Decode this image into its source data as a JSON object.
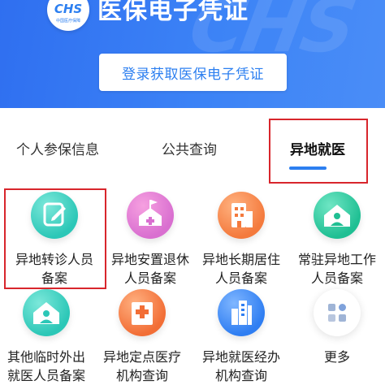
{
  "banner": {
    "logo_mark": "CHS",
    "logo_org": "中国医疗保障",
    "watermark": "CHS",
    "title": "医保电子凭证",
    "login_button": "登录获取医保电子凭证"
  },
  "tabs": [
    {
      "label": "个人参保信息",
      "active": false
    },
    {
      "label": "公共查询",
      "active": false
    },
    {
      "label": "异地就医",
      "active": true
    }
  ],
  "services": [
    {
      "line1": "异地转诊人员",
      "line2": "备案",
      "icon": "edit-icon",
      "color": "#2cc7b7"
    },
    {
      "line1": "异地安置退休",
      "line2": "人员备案",
      "icon": "house-flag-icon",
      "color": "#d96fd0"
    },
    {
      "line1": "异地长期居住",
      "line2": "人员备案",
      "icon": "building-icon",
      "color": "#f47a3d"
    },
    {
      "line1": "常驻异地工作",
      "line2": "人员备案",
      "icon": "home-person-icon",
      "color": "#1fbf93"
    },
    {
      "line1": "其他临时外出",
      "line2": "就医人员备案",
      "icon": "home-person-icon",
      "color": "#2cc7b7"
    },
    {
      "line1": "异地定点医疗",
      "line2": "机构查询",
      "icon": "hospital-icon",
      "color": "#f26e36"
    },
    {
      "line1": "异地就医经办",
      "line2": "机构查询",
      "icon": "office-tower-icon",
      "color": "#2f7ef2"
    },
    {
      "line1": "更多",
      "line2": "",
      "icon": "more-apps-icon",
      "color": "#cfd6e2"
    }
  ],
  "accent_color": "#2c7ff0",
  "highlight_color": "#d8262c"
}
